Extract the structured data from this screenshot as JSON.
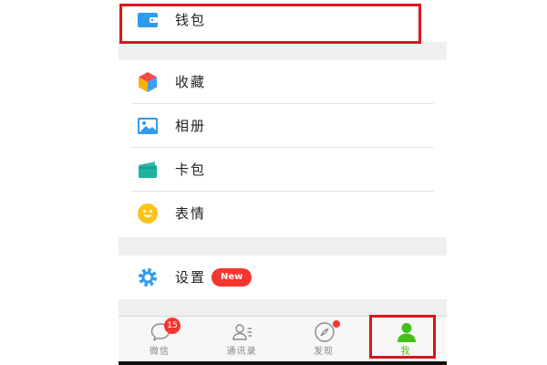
{
  "menu": {
    "wallet": {
      "label": "钱包",
      "icon": "wallet-icon"
    },
    "favorites": {
      "label": "收藏",
      "icon": "cube-icon"
    },
    "album": {
      "label": "相册",
      "icon": "image-icon"
    },
    "cards": {
      "label": "卡包",
      "icon": "card-icon"
    },
    "stickers": {
      "label": "表情",
      "icon": "smiley-icon"
    },
    "settings": {
      "label": "设置",
      "icon": "gear-icon",
      "badge": "New"
    }
  },
  "tabbar": {
    "tabs": [
      {
        "label": "微信",
        "icon": "chat-bubble-icon",
        "badge": "15"
      },
      {
        "label": "通讯录",
        "icon": "contacts-icon"
      },
      {
        "label": "发现",
        "icon": "compass-icon",
        "dot": true
      },
      {
        "label": "我",
        "icon": "person-icon",
        "active": true
      }
    ]
  },
  "colors": {
    "accent": "#45c01a",
    "badge": "#f43530",
    "highlight": "#d9171b",
    "background": "#efefef"
  }
}
